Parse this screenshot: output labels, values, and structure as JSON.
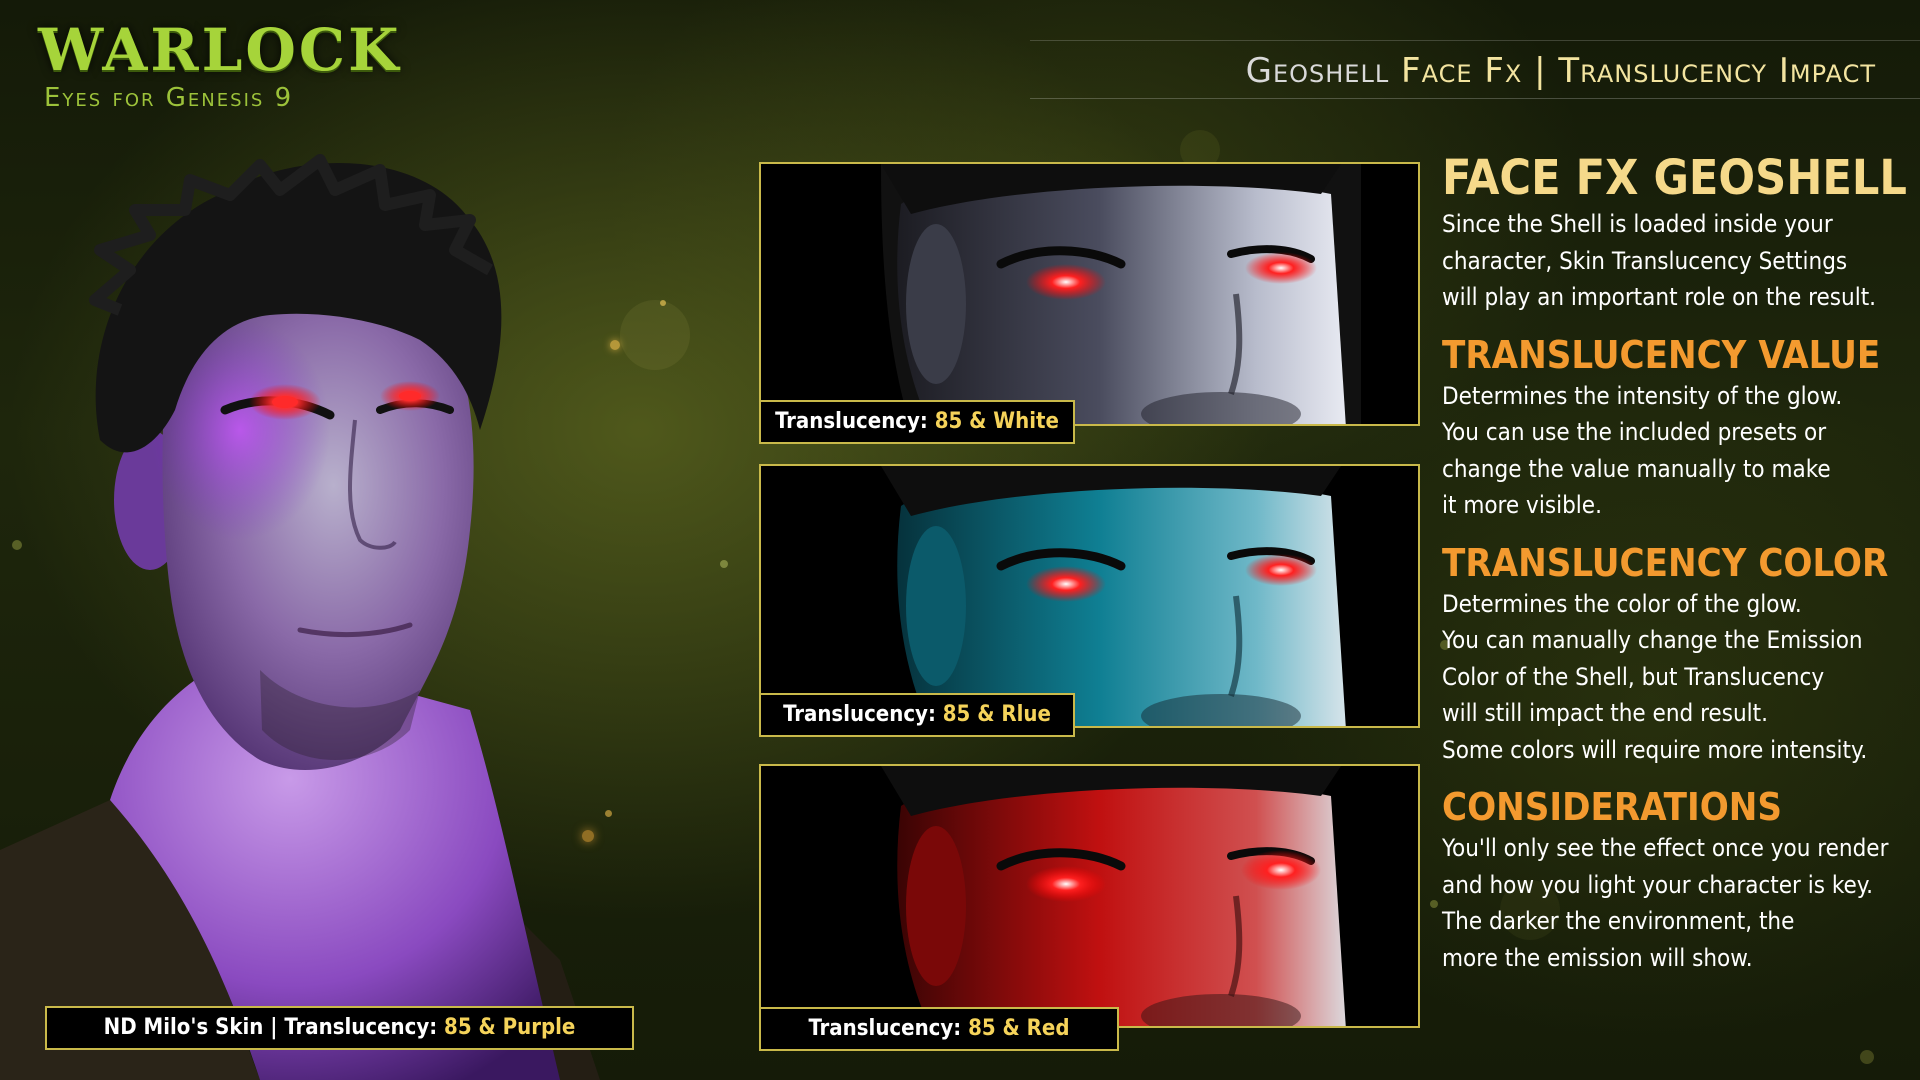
{
  "logo": {
    "title": "Warlock",
    "subtitle": "Eyes for Genesis 9"
  },
  "header": {
    "part1": "Geoshell",
    "part2": "Face Fx",
    "separator": "|",
    "part3": "Translucency Impact"
  },
  "main_caption": {
    "label": "ND Milo's Skin | Translucency:",
    "value": "85 & Purple"
  },
  "panels": [
    {
      "label": "Translucency:",
      "value": "85 & White",
      "tint": "#9aa0b4"
    },
    {
      "label": "Translucency:",
      "value": "85 & Rlue",
      "tint": "#1aa6bf"
    },
    {
      "label": "Translucency:",
      "value": "85 & Red",
      "tint": "#c41010"
    }
  ],
  "info": {
    "sections": [
      {
        "title": "FACE FX GEOSHELL",
        "lines": [
          "Since the Shell is loaded inside your",
          "character, Skin Translucency Settings",
          "will play an important role on the result."
        ]
      },
      {
        "title": "TRANSLUCENCY VALUE",
        "lines": [
          "Determines the intensity of the glow.",
          "You can use the included presets or",
          "change the value manually to make",
          "it more visible."
        ]
      },
      {
        "title": "TRANSLUCENCY COLOR",
        "lines": [
          "Determines the color of the glow.",
          "You can manually change the Emission",
          "Color of the Shell, but Translucency",
          "will still impact the end result.",
          "Some colors will require more intensity."
        ]
      },
      {
        "title": "CONSIDERATIONS",
        "lines": [
          "You'll only see the effect once you render",
          "and how you light your character is key.",
          "The darker the environment, the",
          "more the emission will show."
        ]
      }
    ]
  },
  "colors": {
    "accent_gold": "#f5d35a",
    "section_orange": "#f39a2f",
    "border_gold": "#c9b94a",
    "logo_green": "#a6d43a",
    "skin_purple": "#9b5cc4",
    "eye_red": "#ff2020"
  }
}
